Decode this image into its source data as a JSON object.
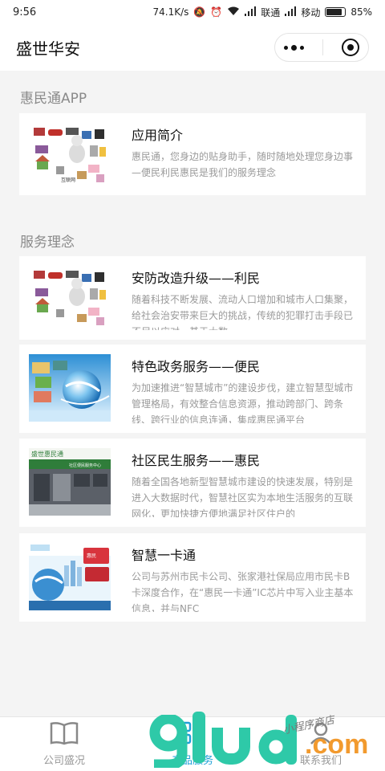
{
  "status_bar": {
    "time": "9:56",
    "speed": "74.1K/s",
    "carrier1": "联通",
    "carrier2": "移动",
    "battery": "85%",
    "battery_level": 0.85
  },
  "nav": {
    "title": "盛世华安"
  },
  "sections": [
    {
      "title": "惠民通APP",
      "items": [
        {
          "title": "应用简介",
          "desc": "惠民通，您身边的贴身助手，随时随地处理您身边事—便民利民惠民是我们的服务理念",
          "thumb": "security-collage"
        }
      ]
    },
    {
      "title": "服务理念",
      "items": [
        {
          "title": "安防改造升级——利民",
          "desc": "随着科技不断发展、流动人口增加和城市人口集聚，给社会治安带来巨大的挑战，传统的犯罪打击手段已不足以应对。基于大数",
          "thumb": "security-collage"
        },
        {
          "title": "特色政务服务——便民",
          "desc": "为加速推进“智慧城市”的建设步伐，建立智慧型城市管理格局，有效整合信息资源，推动跨部门、跨条线、跨行业的信息连通，集成惠民通平台",
          "thumb": "smart-city-globe"
        },
        {
          "title": "社区民生服务——惠民",
          "desc": "随着全国各地新型智慧城市建设的快速发展，特别是进入大数据时代，智慧社区实为本地生活服务的互联网化，更加快捷方便地满足社区住户的",
          "thumb": "community-storefront"
        },
        {
          "title": "智慧一卡通",
          "desc": "公司与苏州市民卡公司、张家港社保局应用市民卡B卡深度合作，在“惠民一卡通”IC芯片中写入业主基本信息，并与NFC",
          "thumb": "smart-card"
        }
      ]
    }
  ],
  "tabs": [
    {
      "label": "公司盛况",
      "icon": "book-icon"
    },
    {
      "label": "产品服务",
      "icon": "grid-icon",
      "active": true
    },
    {
      "label": "联系我们",
      "icon": "contact-icon"
    }
  ],
  "thumb_text": {
    "community_sign": "盛世惠民通",
    "community_sign2": "社区便民服务中心",
    "card_brand": "惠民",
    "collage_label": "互联网"
  },
  "watermark": {
    "com": ".com",
    "shop": "小程序商店"
  },
  "colors": {
    "accent": "#1fa0d8",
    "watermark_green": "#2ec9a8",
    "watermark_orange": "#f29a2e"
  }
}
